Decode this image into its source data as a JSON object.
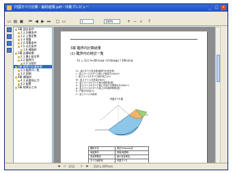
{
  "window": {
    "title": "円弧すべり計算 - 解析結果.pdf - 印刷プレビュー",
    "controls": [
      "_",
      "□",
      "×"
    ]
  },
  "menu": [
    "ファイル(F)",
    "編集(E)",
    "表示(V)",
    "ツール(T)",
    "ヘルプ(H)"
  ],
  "toolbar": {
    "page_field": "1",
    "page_total": "/ 12",
    "zoom_field": "100%",
    "icons": [
      "open-icon",
      "print-icon",
      "save-icon",
      "first-page-icon",
      "prev-page-icon",
      "next-page-icon",
      "last-page-icon",
      "zoom-in-icon",
      "zoom-out-icon",
      "help-icon"
    ]
  },
  "tree": {
    "items": [
      {
        "label": "1章 設計条件",
        "indent": 0
      },
      {
        "label": "1.1 計算条件",
        "indent": 1
      },
      {
        "label": "1.2 土質定数",
        "indent": 1
      },
      {
        "label": "1.3 地盤",
        "indent": 1
      },
      {
        "label": "1.4 荷重条件",
        "indent": 1
      },
      {
        "label": "1.5 水位条件",
        "indent": 1
      },
      {
        "label": "1.6 補強材",
        "indent": 2
      },
      {
        "label": "2章 計算結果",
        "indent": 0
      },
      {
        "label": "2.1 最小安全率",
        "indent": 1
      },
      {
        "label": "2.2 臨界円",
        "indent": 1
      },
      {
        "label": "2.3 分割片",
        "indent": 2
      },
      {
        "label": "3章 臨界円計算結果",
        "indent": 0
      },
      {
        "label": "3.1 臨界円一覧",
        "indent": 1
      },
      {
        "label": "3.2 詳細",
        "indent": 1
      },
      {
        "label": "4章 補強材",
        "indent": 0
      },
      {
        "label": "4.1 必要抑止力",
        "indent": 1
      },
      {
        "label": "4.2 配置",
        "indent": 1
      },
      {
        "label": "5章 結果まとめ",
        "indent": 0
      }
    ]
  },
  "document": {
    "heading1": "3章 臨界円計算結果",
    "heading2": "(1) 臨界円の検討一覧",
    "formula": "Fs = Σ{c·l+(W·cosα−U·l)tanφ} / ΣW·sinα",
    "notes": [
      "Fs : 最小すべり安全率(臨界円の安全率)",
      "c  : 各スライスのすべり面上の粘着力(kN/m²)",
      "l  : 各スライスのすべり面の長さ(m)",
      "W  : 各スライスの重量(kN/m)",
      "α  : 各スライスのすべり面の傾斜角(度)",
      "U  : 各スライスのすべり面に作用する間隙水圧(kN/m²)",
      "φ  : 各スライスのすべり面上の内部摩擦角(度)",
      "R  : 円弧の半径(m)",
      "Σ  : 全スライスの総和"
    ],
    "figure_label": "円弧すべり図",
    "table": [
      [
        "解析手法",
        "修正Fellenius法"
      ],
      [
        "地盤条件",
        "常時/地震時"
      ],
      [
        "安全率算定",
        "最小安全率法"
      ],
      [
        "すべり面形状",
        "円弧すべり"
      ],
      [
        "計画安全率 Fs",
        "1.200"
      ],
      [
        "最小安全率 Fsmin",
        "1.326"
      ]
    ]
  },
  "statusbar": {
    "page_info": "1/12",
    "size_info": "210 x 297mm"
  }
}
